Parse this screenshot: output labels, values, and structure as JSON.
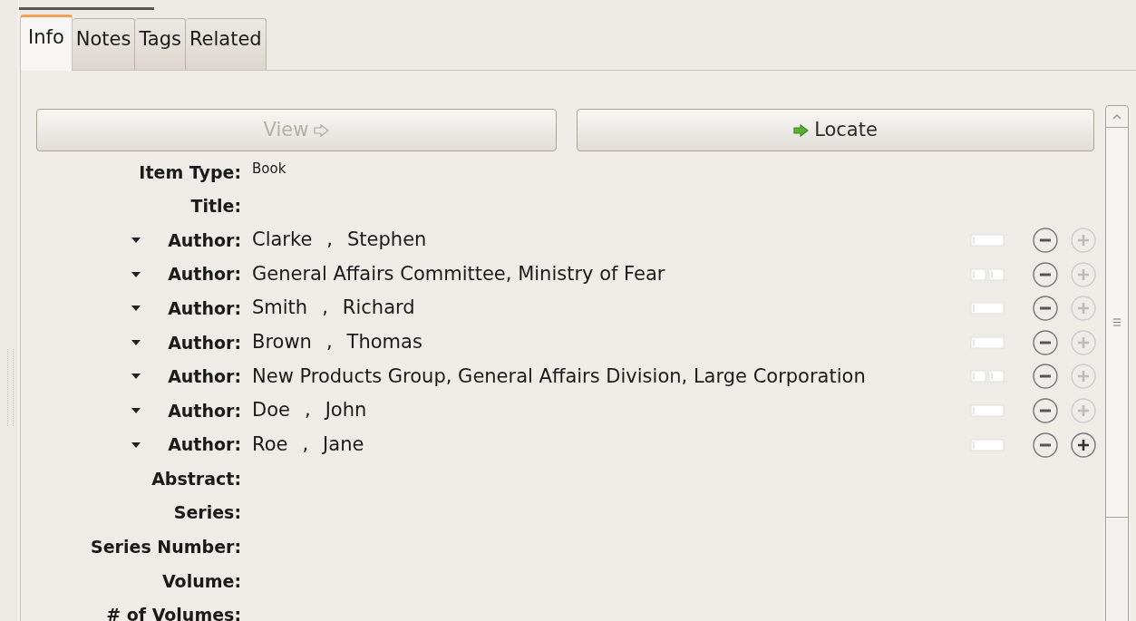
{
  "tabs": [
    {
      "label": "Info",
      "selected": true
    },
    {
      "label": "Notes",
      "selected": false
    },
    {
      "label": "Tags",
      "selected": false
    },
    {
      "label": "Related",
      "selected": false
    }
  ],
  "buttons": [
    {
      "label": "View",
      "disabled": true
    },
    {
      "label": "Locate",
      "disabled": false
    }
  ],
  "fields": [
    {
      "kind": "text",
      "label": "Item Type:",
      "value": "Book"
    },
    {
      "kind": "text",
      "label": "Title:"
    },
    {
      "kind": "creator",
      "label": "Author:",
      "last": "Clarke",
      "separator": ",",
      "first": "Stephen",
      "add_disabled": true
    },
    {
      "kind": "creator",
      "label": "Author:",
      "last": "General Affairs Committee, Ministry of Fear",
      "add_disabled": true
    },
    {
      "kind": "creator",
      "label": "Author:",
      "last": "Smith",
      "separator": ",",
      "first": "Richard",
      "add_disabled": true
    },
    {
      "kind": "creator",
      "label": "Author:",
      "last": "Brown",
      "separator": ",",
      "first": "Thomas",
      "add_disabled": true
    },
    {
      "kind": "creator",
      "label": "Author:",
      "last": "New Products Group, General Affairs Division, Large Corporation",
      "add_disabled": true
    },
    {
      "kind": "creator",
      "label": "Author:",
      "last": "Doe",
      "separator": ",",
      "first": "John",
      "add_disabled": true
    },
    {
      "kind": "creator",
      "label": "Author:",
      "last": "Roe",
      "separator": ",",
      "first": "Jane",
      "add_disabled": false
    },
    {
      "kind": "text",
      "label": "Abstract:"
    },
    {
      "kind": "text",
      "label": "Series:"
    },
    {
      "kind": "text",
      "label": "Series Number:"
    },
    {
      "kind": "text",
      "label": "Volume:"
    },
    {
      "kind": "text",
      "label": "# of Volumes:"
    }
  ]
}
